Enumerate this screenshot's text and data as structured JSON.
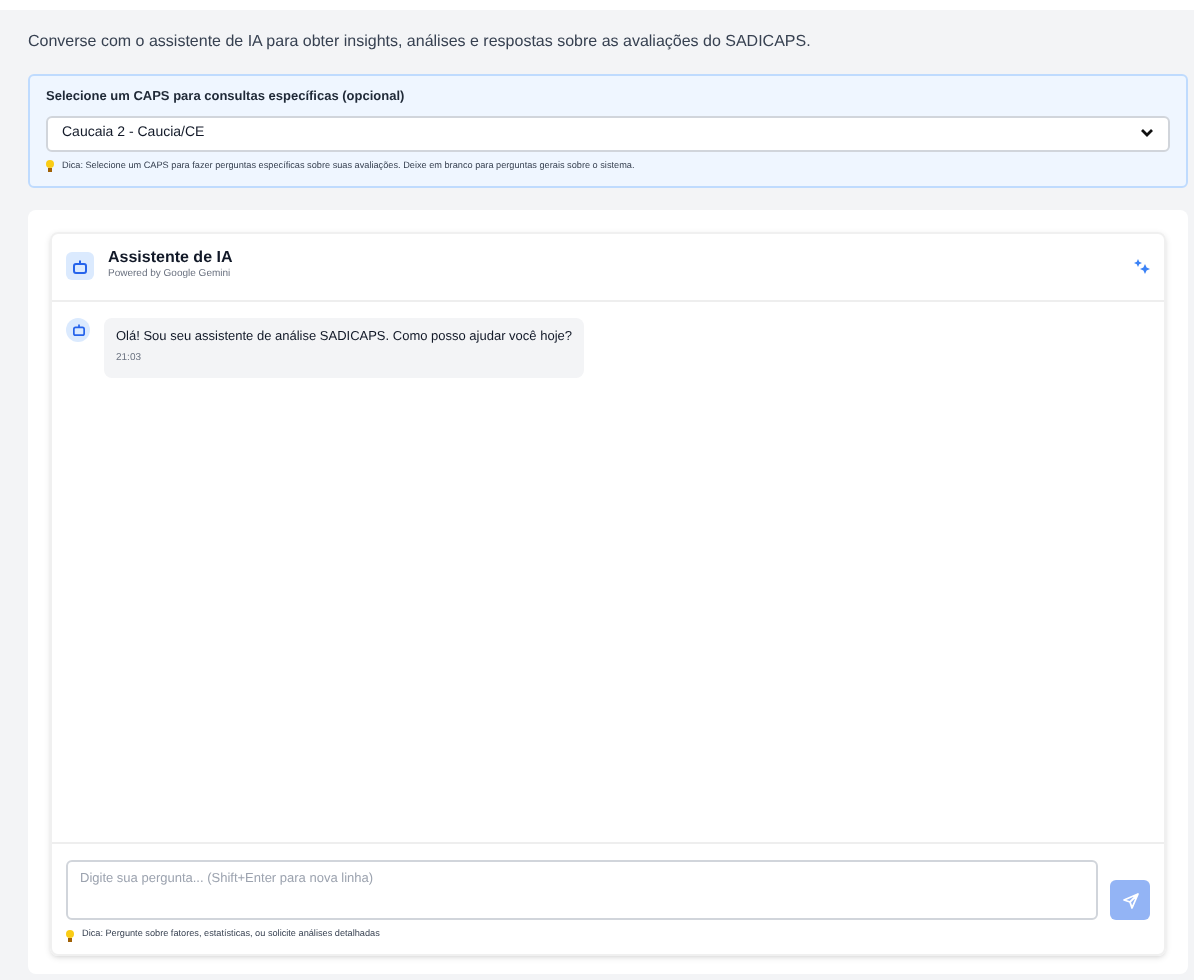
{
  "intro": "Converse com o assistente de IA para obter insights, análises e respostas sobre as avaliações do SADICAPS.",
  "caps_selector": {
    "label": "Selecione um CAPS para consultas específicas (opcional)",
    "value": "Caucaia 2 - Caucia/CE",
    "tip": "Dica: Selecione um CAPS para fazer perguntas específicas sobre suas avaliações. Deixe em branco para perguntas gerais sobre o sistema."
  },
  "chat": {
    "title": "Assistente de IA",
    "subtitle": "Powered by Google Gemini",
    "messages": [
      {
        "kind": "assistant",
        "text": "Olá! Sou seu assistente de análise SADICAPS. Como posso ajudar você hoje?",
        "time": "21:03"
      }
    ],
    "input": {
      "placeholder": "Digite sua pergunta... (Shift+Enter para nova linha)"
    },
    "send_button": {
      "disabled": true
    },
    "tip": "Dica: Pergunte sobre fatores, estatísticas, ou solicite análises detalhadas"
  }
}
